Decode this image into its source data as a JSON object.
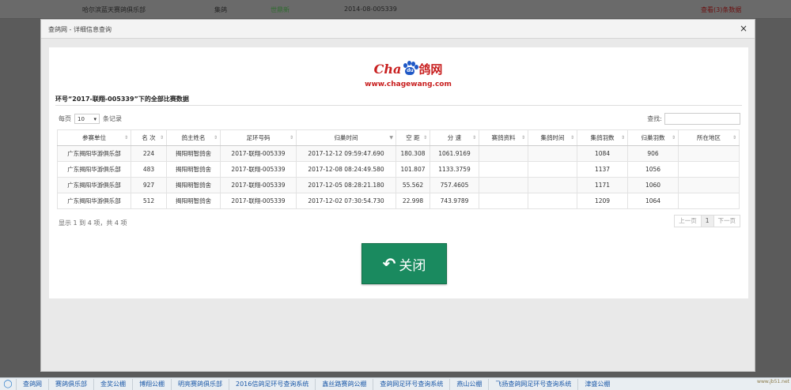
{
  "background_row": {
    "club": "哈尔滨蓝天赛鸽俱乐部",
    "category": "集鸽",
    "status": "世鼎新",
    "ring": "2014-08-005339",
    "link": "查看(3)条数据"
  },
  "modal": {
    "title": "查鸽网 - 详细信息查询",
    "close_icon": "×"
  },
  "logo": {
    "cha": "Cha",
    "paw_text": "du",
    "ge": "鸽网",
    "url": "www.chagewang.com"
  },
  "heading": "环号“2017-联翔-005339”下的全部比赛数据",
  "length_menu": {
    "prefix": "每页",
    "value": "10",
    "suffix": "条记录"
  },
  "search": {
    "label": "查找:"
  },
  "table": {
    "columns": [
      "参赛单位",
      "名 次",
      "鸽主姓名",
      "足环号码",
      "归巢时间",
      "空 距",
      "分 速",
      "赛鸽资料",
      "集鸽时间",
      "集鸽羽数",
      "归巢羽数",
      "所在地区"
    ],
    "rows": [
      [
        "广东揭阳华游俱乐部",
        "224",
        "揭阳明智鸽舍",
        "2017-联翔-005339",
        "2017-12-12 09:59:47.690",
        "180.308",
        "1061.9169",
        "",
        "",
        "1084",
        "906",
        ""
      ],
      [
        "广东揭阳华游俱乐部",
        "483",
        "揭阳明智鸽舍",
        "2017-联翔-005339",
        "2017-12-08 08:24:49.580",
        "101.807",
        "1133.3759",
        "",
        "",
        "1137",
        "1056",
        ""
      ],
      [
        "广东揭阳华游俱乐部",
        "927",
        "揭阳明智鸽舍",
        "2017-联翔-005339",
        "2017-12-05 08:28:21.180",
        "55.562",
        "757.4605",
        "",
        "",
        "1171",
        "1060",
        ""
      ],
      [
        "广东揭阳华游俱乐部",
        "512",
        "揭阳明智鸽舍",
        "2017-联翔-005339",
        "2017-12-02 07:30:54.730",
        "22.998",
        "743.9789",
        "",
        "",
        "1209",
        "1064",
        ""
      ]
    ]
  },
  "info": "显示 1 到 4 项，共 4 项",
  "pager": {
    "prev": "上一页",
    "current": "1",
    "next": "下一页"
  },
  "close_button": {
    "label": "关闭"
  },
  "taskbar": {
    "items": [
      "查鸽网",
      "赛鸽俱乐部",
      "金奖公棚",
      "博翔公棚",
      "明亮赛鸽俱乐部",
      "2016信鸽足环号查询系统",
      "鑫丝路赛鸽公棚",
      "查鸽网足环号查询系统",
      "燕山公棚",
      "飞扬查鸽网足环号查询系统",
      "津盛公棚"
    ],
    "corner": "www.jb51.net"
  },
  "colors": {
    "accent_button": "#1a8a5f",
    "logo_red": "#c81f1f",
    "logo_blue": "#1f58c6"
  }
}
